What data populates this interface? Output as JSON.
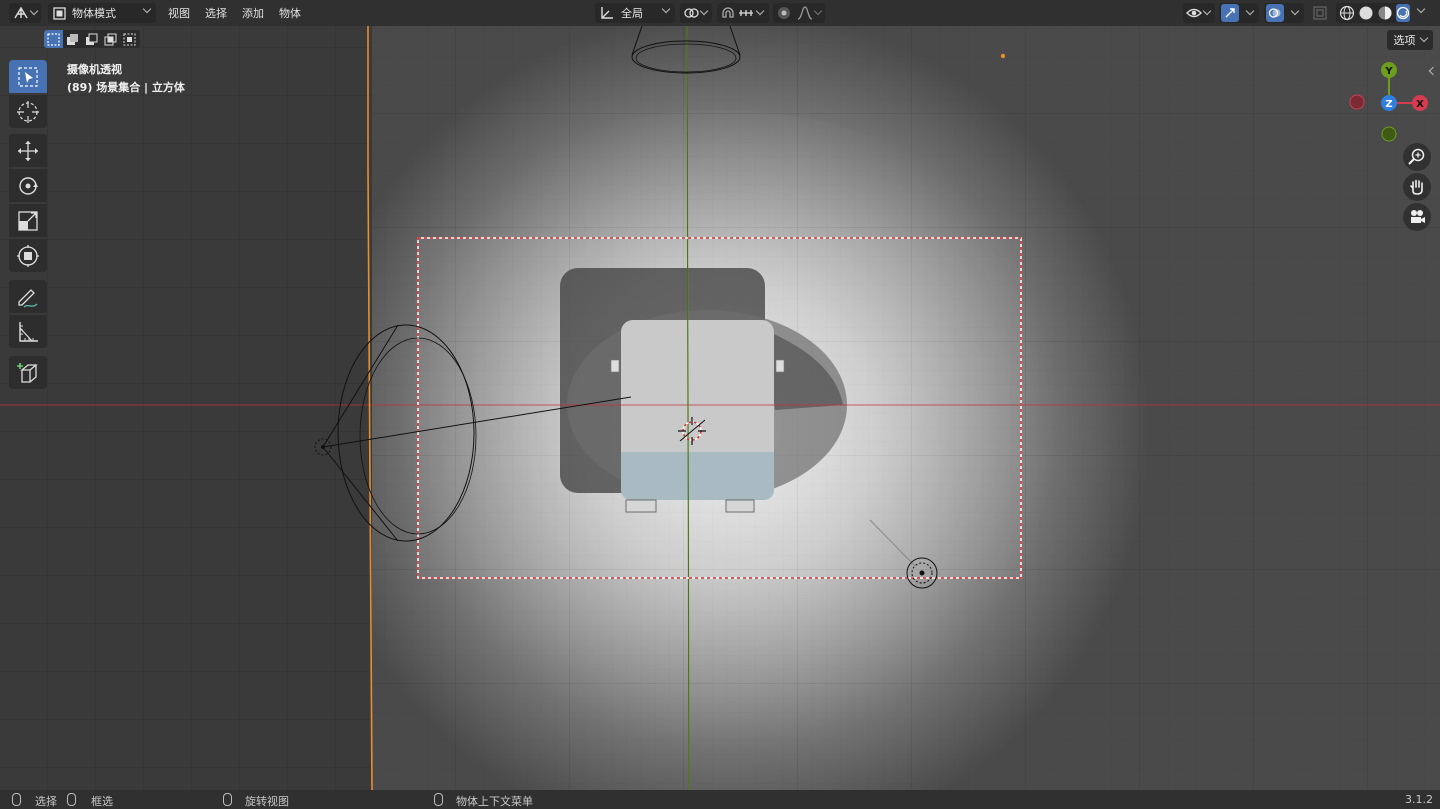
{
  "header": {
    "editor_type_icon": "3d-viewport-icon",
    "mode": {
      "icon": "object-mode-icon",
      "label": "物体模式"
    },
    "menus": [
      "视图",
      "选择",
      "添加",
      "物体"
    ],
    "transform_orientation": {
      "icon": "orientation-icon",
      "label": "全局"
    },
    "pivot_icon": "pivot-icon",
    "snap_icon": "snap-magnet-icon",
    "snap_target_icon": "snap-increment-icon",
    "proportional_icon": "proportional-edit-icon",
    "falloff_icon": "falloff-curve-icon",
    "visibility_icon": "eye-icon",
    "gizmo_icon": "gizmo-icon",
    "overlay_icon": "overlay-icon",
    "xray_icon": "xray-icon",
    "shading_modes": [
      "wireframe",
      "solid",
      "material-preview",
      "rendered"
    ],
    "active_shading": "rendered"
  },
  "subbar": {
    "select_modes": [
      "set",
      "extend",
      "subtract",
      "invert",
      "intersect"
    ],
    "options_label": "选项"
  },
  "toolbar": {
    "tools": [
      "select-box",
      "cursor",
      "move",
      "rotate",
      "scale",
      "transform",
      "annotate",
      "measure",
      "add-cube"
    ],
    "active": "select-box"
  },
  "viewport": {
    "view_name": "摄像机透视",
    "collection_info": "(89) 场景集合 | 立方体"
  },
  "gizmo": {
    "axes": [
      {
        "label": "Y",
        "color": "#6d9e1e"
      },
      {
        "label": "Z",
        "color": "#2f7fe0"
      },
      {
        "label": "X",
        "color": "#d63c4f"
      }
    ],
    "buttons": [
      "zoom-icon",
      "hand-pan-icon",
      "camera-view-icon"
    ]
  },
  "status": {
    "items": [
      {
        "icon": "mouse-left-icon",
        "label": "选择"
      },
      {
        "icon": "mouse-drag-icon",
        "label": "框选"
      },
      {
        "icon": "mouse-middle-icon",
        "label": "旋转视图"
      },
      {
        "icon": "mouse-right-icon",
        "label": "物体上下文菜单"
      }
    ],
    "version": "3.1.2"
  },
  "colors": {
    "accent": "#4772b3",
    "x_axis": "#d63c4f",
    "y_axis": "#6d9e1e",
    "z_axis": "#2f7fe0",
    "camera_line": "#e7902b"
  }
}
